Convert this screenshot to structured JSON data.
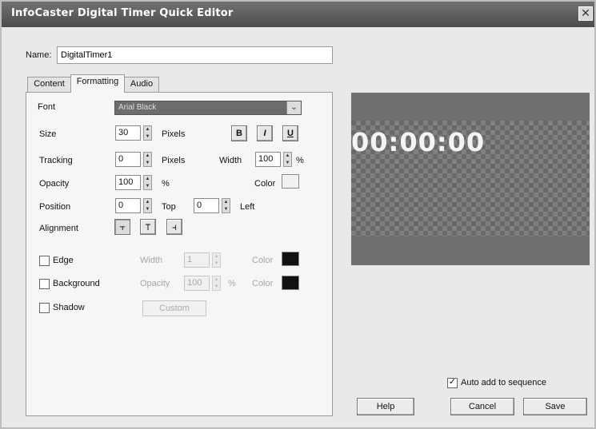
{
  "window": {
    "title": "InfoCaster Digital Timer Quick Editor",
    "close_glyph": "✕"
  },
  "name_field": {
    "label": "Name:",
    "value": "DigitalTimer1"
  },
  "tabs": [
    {
      "label": "Content",
      "active": false
    },
    {
      "label": "Formatting",
      "active": true
    },
    {
      "label": "Audio",
      "active": false
    }
  ],
  "formatting": {
    "font": {
      "label": "Font",
      "value": "Arial Black",
      "arrow": "⌄"
    },
    "size": {
      "label": "Size",
      "value": "30",
      "unit": "Pixels"
    },
    "style_buttons": [
      {
        "icon": "bold-icon",
        "glyph": "B"
      },
      {
        "icon": "italic-icon",
        "glyph": "I"
      },
      {
        "icon": "underline-icon",
        "glyph": "U"
      }
    ],
    "tracking": {
      "label": "Tracking",
      "value": "0",
      "unit": "Pixels"
    },
    "width": {
      "label": "Width",
      "value": "100",
      "unit": "%"
    },
    "opacity": {
      "label": "Opacity",
      "value": "100",
      "unit": "%"
    },
    "color": {
      "label": "Color",
      "swatch": "#f1f1f1"
    },
    "position": {
      "label": "Position",
      "top_value": "0",
      "top_label": "Top",
      "left_value": "0",
      "left_label": "Left"
    },
    "alignment": {
      "label": "Alignment",
      "buttons": [
        {
          "icon": "align-top-icon",
          "glyph": "⫟",
          "pressed": true
        },
        {
          "icon": "align-middle-icon",
          "glyph": "⊤",
          "pressed": false
        },
        {
          "icon": "align-bottom-icon",
          "glyph": "⫞",
          "pressed": false
        }
      ]
    },
    "edge": {
      "label": "Edge",
      "checked": false,
      "width_label": "Width",
      "width_value": "1",
      "color_label": "Color",
      "color": "#111111"
    },
    "background": {
      "label": "Background",
      "checked": false,
      "opacity_label": "Opacity",
      "opacity_value": "100",
      "unit": "%",
      "color_label": "Color",
      "color": "#111111"
    },
    "shadow": {
      "label": "Shadow",
      "checked": false,
      "custom_label": "Custom"
    }
  },
  "preview": {
    "timer_text": "00:00:00"
  },
  "footer": {
    "auto_add_label": "Auto add to sequence",
    "auto_add_checked": true,
    "check_glyph": "✓",
    "help_label": "Help",
    "cancel_label": "Cancel",
    "save_label": "Save"
  }
}
